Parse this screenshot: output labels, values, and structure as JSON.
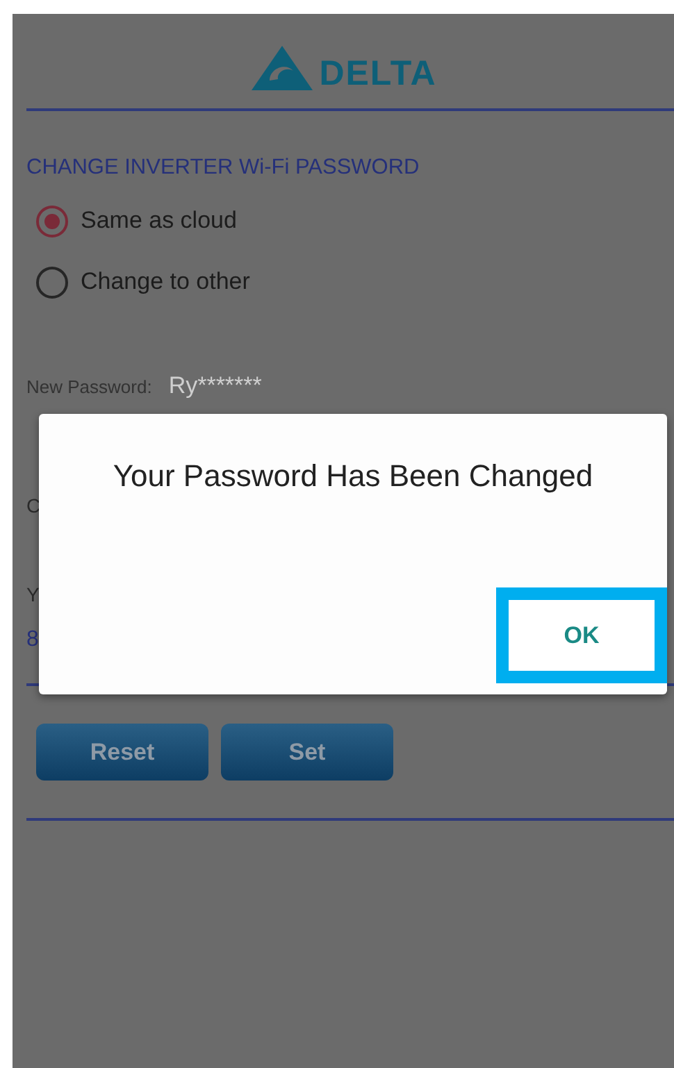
{
  "logo": {
    "text": "DELTA"
  },
  "section_title": "CHANGE INVERTER Wi-Fi PASSWORD",
  "options": [
    {
      "label": "Same as cloud",
      "selected": true
    },
    {
      "label": "Change to other",
      "selected": false
    }
  ],
  "new_password": {
    "label": "New Password:",
    "value": "Ry*******"
  },
  "covered_fragments": [
    "C",
    "Y",
    "8"
  ],
  "buttons": [
    "Reset",
    "Set"
  ],
  "dialog": {
    "message": "Your Password Has Been Changed",
    "button": "OK"
  }
}
